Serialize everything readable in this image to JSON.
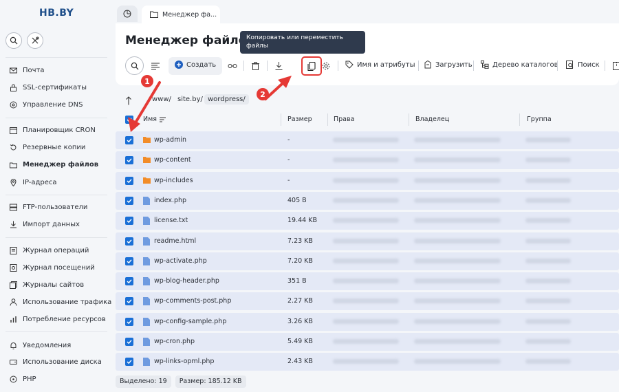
{
  "app": {
    "logo": "HB.BY"
  },
  "sidebar": {
    "items": [
      {
        "label": "Почта",
        "icon": "mail-icon"
      },
      {
        "label": "SSL-сертификаты",
        "icon": "lock-icon"
      },
      {
        "label": "Управление DNS",
        "icon": "dns-icon"
      },
      {
        "label": "Планировщик CRON",
        "icon": "calendar-icon"
      },
      {
        "label": "Резервные копии",
        "icon": "backup-icon"
      },
      {
        "label": "Менеджер файлов",
        "icon": "cloud-folder-icon",
        "active": true
      },
      {
        "label": "IP-адреса",
        "icon": "location-icon"
      },
      {
        "label": "FTP-пользователи",
        "icon": "ftp-icon"
      },
      {
        "label": "Импорт данных",
        "icon": "import-icon"
      },
      {
        "label": "Журнал операций",
        "icon": "log-icon"
      },
      {
        "label": "Журнал посещений",
        "icon": "visits-icon"
      },
      {
        "label": "Журналы сайтов",
        "icon": "site-logs-icon"
      },
      {
        "label": "Использование трафика",
        "icon": "traffic-icon"
      },
      {
        "label": "Потребление ресурсов",
        "icon": "resources-icon"
      },
      {
        "label": "Уведомления",
        "icon": "bell-icon"
      },
      {
        "label": "Использование диска",
        "icon": "disk-icon"
      },
      {
        "label": "PHP",
        "icon": "php-icon"
      }
    ]
  },
  "tabs": {
    "active_label": "Менеджер фа..."
  },
  "page": {
    "title": "Менеджер файлов"
  },
  "tooltip": {
    "text": "Копировать или переместить файлы"
  },
  "toolbar": {
    "create": "Создать",
    "name_attrs": "Имя и атрибуты",
    "upload": "Загрузить",
    "tree": "Дерево каталогов",
    "search": "Поиск"
  },
  "breadcrumb": {
    "parts": [
      "www/",
      "site.by/",
      "wordpress/"
    ]
  },
  "table": {
    "headers": {
      "name": "Имя",
      "size": "Размер",
      "rights": "Права",
      "owner": "Владелец",
      "group": "Группа"
    },
    "rows": [
      {
        "name": "wp-admin",
        "size": "-",
        "type": "folder"
      },
      {
        "name": "wp-content",
        "size": "-",
        "type": "folder"
      },
      {
        "name": "wp-includes",
        "size": "-",
        "type": "folder"
      },
      {
        "name": "index.php",
        "size": "405 B",
        "type": "file"
      },
      {
        "name": "license.txt",
        "size": "19.44 KB",
        "type": "file"
      },
      {
        "name": "readme.html",
        "size": "7.23 KB",
        "type": "file"
      },
      {
        "name": "wp-activate.php",
        "size": "7.20 KB",
        "type": "file"
      },
      {
        "name": "wp-blog-header.php",
        "size": "351 B",
        "type": "file"
      },
      {
        "name": "wp-comments-post.php",
        "size": "2.27 KB",
        "type": "file"
      },
      {
        "name": "wp-config-sample.php",
        "size": "3.26 KB",
        "type": "file"
      },
      {
        "name": "wp-cron.php",
        "size": "5.49 KB",
        "type": "file"
      },
      {
        "name": "wp-links-opml.php",
        "size": "2.43 KB",
        "type": "file"
      }
    ]
  },
  "footer": {
    "selected": "Выделено: 19",
    "size": "Размер: 185.12 KB"
  },
  "annotations": {
    "badge1": "1",
    "badge2": "2"
  },
  "colors": {
    "accent": "#1a6fd6",
    "annotation": "#e53935",
    "row": "#e4e9f6",
    "folder": "#f28c28",
    "file": "#6f9be0"
  }
}
